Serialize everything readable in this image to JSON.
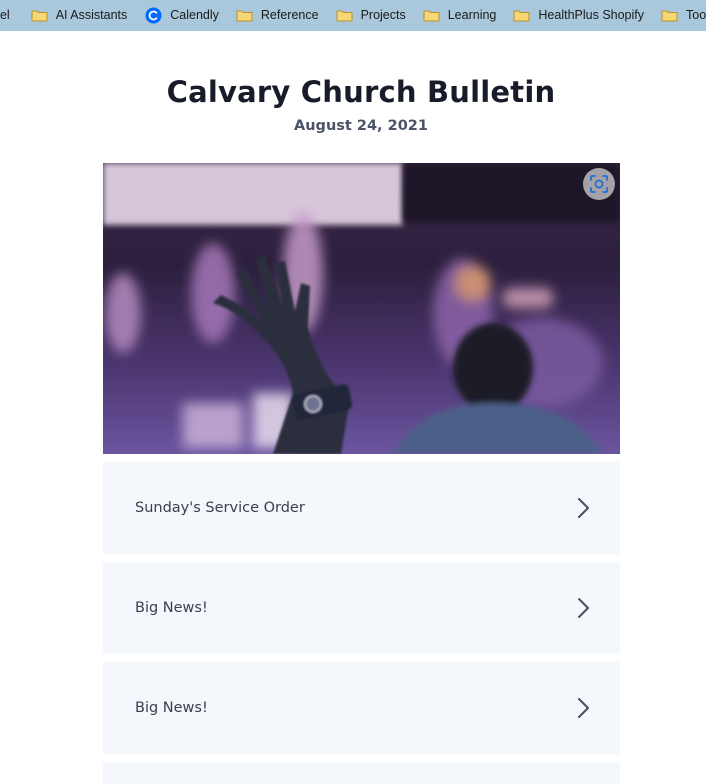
{
  "bookmarks": [
    {
      "label": "pel",
      "icon": "folder-icon"
    },
    {
      "label": "AI Assistants",
      "icon": "folder-icon"
    },
    {
      "label": "Calendly",
      "icon": "calendly-icon"
    },
    {
      "label": "Reference",
      "icon": "folder-icon"
    },
    {
      "label": "Projects",
      "icon": "folder-icon"
    },
    {
      "label": "Learning",
      "icon": "folder-icon"
    },
    {
      "label": "HealthPlus Shopify",
      "icon": "folder-icon"
    },
    {
      "label": "Tools",
      "icon": "folder-icon"
    }
  ],
  "bulletin": {
    "title": "Calvary Church Bulletin",
    "date": "August 24, 2021"
  },
  "hero": {
    "alt_icon": "visual-search-icon"
  },
  "cards": [
    {
      "label": "Sunday's Service Order"
    },
    {
      "label": "Big News!"
    },
    {
      "label": "Big News!"
    }
  ],
  "colors": {
    "bookmarks_bg": "#a9c8dc",
    "title": "#181b29",
    "card_bg": "#f4f7fb"
  }
}
